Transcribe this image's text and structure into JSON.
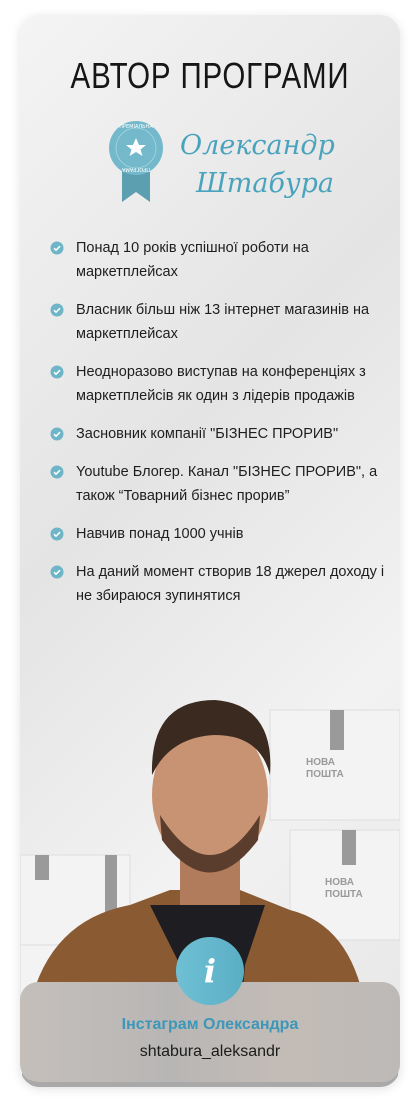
{
  "header": {
    "title": "АВТОР ПРОГРАМИ"
  },
  "badge": {
    "top_text": "ПРЕМІАЛЬНА",
    "bottom_text": "ПРОГРАМА",
    "color": "#6fb5c8"
  },
  "signature": {
    "line1": "Олександр",
    "line2": "Штабура",
    "color": "#4aa3bd"
  },
  "achievements": [
    "Понад 10 років успішної роботи на маркетплейсах",
    "Власник більш ніж 13 інтернет магазинів на маркетплейсах",
    "Неодноразово виступав на конференціях з маркетплейсів як один з лідерів продажів",
    "Засновник компанії \"БІЗНЕС ПРОРИВ\"",
    "Youtube Блогер. Канал \"БІЗНЕС ПРОРИВ\", а також “Товарний бізнес прорив”",
    "Навчив понад 1000 учнів",
    "На даний момент створив 18 джерел доходу і не збираюся зупинятися"
  ],
  "photo": {
    "box_label_1": "НОВА",
    "box_label_2": "ПОШТА"
  },
  "instagram": {
    "icon": "info-icon",
    "title": "Інстаграм Олександра",
    "username": "shtabura_aleksandr",
    "accent": "#3c97b8"
  }
}
